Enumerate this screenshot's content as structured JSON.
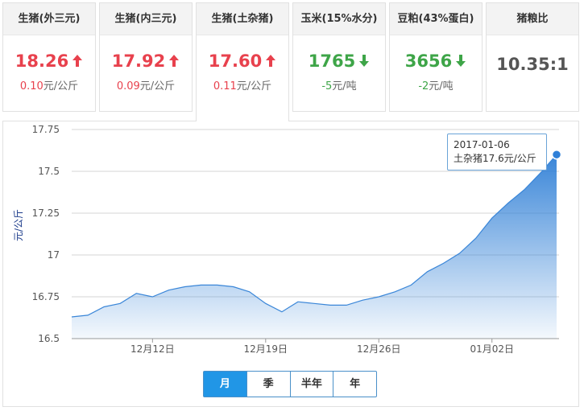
{
  "cards": [
    {
      "title": "生猪(外三元)",
      "value": "18.26",
      "direction": "up",
      "change": "0.10",
      "unit": "元/公斤"
    },
    {
      "title": "生猪(内三元)",
      "value": "17.92",
      "direction": "up",
      "change": "0.09",
      "unit": "元/公斤"
    },
    {
      "title": "生猪(土杂猪)",
      "value": "17.60",
      "direction": "up",
      "change": "0.11",
      "unit": "元/公斤",
      "active": true
    },
    {
      "title": "玉米(15%水分)",
      "value": "1765",
      "direction": "down",
      "change": "-5",
      "unit": "元/吨"
    },
    {
      "title": "豆粕(43%蛋白)",
      "value": "3656",
      "direction": "down",
      "change": "-2",
      "unit": "元/吨"
    },
    {
      "title": "猪粮比",
      "value": "10.35:1",
      "direction": "none",
      "change": "",
      "unit": ""
    }
  ],
  "colors": {
    "up": "#e8414d",
    "down": "#3ea548",
    "accent": "#2196e6",
    "line": "#3a86d8"
  },
  "tooltip": {
    "date": "2017-01-06",
    "text": "土杂猪17.6元/公斤"
  },
  "range_tabs": [
    {
      "label": "月",
      "active": true
    },
    {
      "label": "季",
      "active": false
    },
    {
      "label": "半年",
      "active": false
    },
    {
      "label": "年",
      "active": false
    }
  ],
  "chart_data": {
    "type": "area",
    "title": "",
    "ylabel": "元/公斤",
    "xlabel": "",
    "ylim": [
      16.5,
      17.75
    ],
    "yticks": [
      "16.5",
      "16.75",
      "17",
      "17.25",
      "17.5",
      "17.75"
    ],
    "xticks": [
      {
        "label": "12月12日",
        "date": "2016-12-12"
      },
      {
        "label": "12月19日",
        "date": "2016-12-19"
      },
      {
        "label": "12月26日",
        "date": "2016-12-26"
      },
      {
        "label": "01月02日",
        "date": "2017-01-02"
      }
    ],
    "grid": true,
    "x": [
      "2016-12-07",
      "2016-12-08",
      "2016-12-09",
      "2016-12-10",
      "2016-12-11",
      "2016-12-12",
      "2016-12-13",
      "2016-12-14",
      "2016-12-15",
      "2016-12-16",
      "2016-12-17",
      "2016-12-18",
      "2016-12-19",
      "2016-12-20",
      "2016-12-21",
      "2016-12-22",
      "2016-12-23",
      "2016-12-24",
      "2016-12-25",
      "2016-12-26",
      "2016-12-27",
      "2016-12-28",
      "2016-12-29",
      "2016-12-30",
      "2016-12-31",
      "2017-01-01",
      "2017-01-02",
      "2017-01-03",
      "2017-01-04",
      "2017-01-05",
      "2017-01-06"
    ],
    "series": [
      {
        "name": "土杂猪",
        "values": [
          16.63,
          16.64,
          16.69,
          16.71,
          16.77,
          16.75,
          16.79,
          16.81,
          16.82,
          16.82,
          16.81,
          16.78,
          16.71,
          16.66,
          16.72,
          16.71,
          16.7,
          16.7,
          16.73,
          16.75,
          16.78,
          16.82,
          16.9,
          16.95,
          17.01,
          17.1,
          17.22,
          17.31,
          17.39,
          17.49,
          17.6
        ]
      }
    ]
  }
}
